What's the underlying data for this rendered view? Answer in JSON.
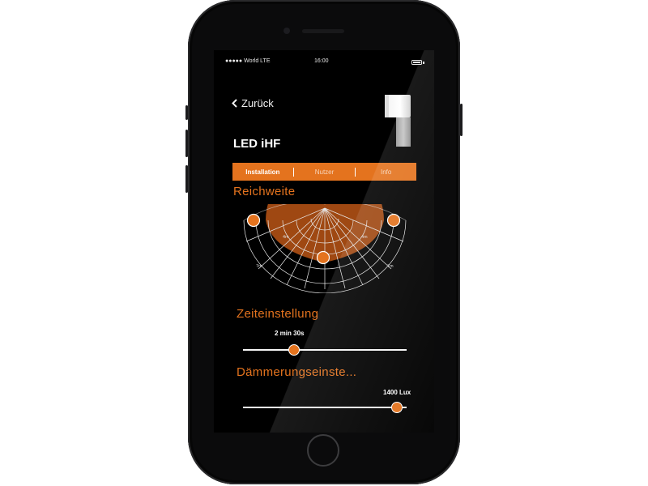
{
  "status_bar": {
    "carrier": "●●●●● World LTE",
    "time": "16:00",
    "battery_icon": "battery-icon"
  },
  "nav": {
    "back_label": "Zurück",
    "back_icon": "chevron-left-icon"
  },
  "device": {
    "title": "LED iHF",
    "image": "sensor-light-product-image"
  },
  "tabs": [
    {
      "label": "Installation",
      "active": true
    },
    {
      "label": "Nutzer",
      "active": false
    },
    {
      "label": "Info",
      "active": false
    }
  ],
  "reichweite": {
    "heading": "Reichweite",
    "ring_labels": [
      "4m",
      "4m",
      "7m",
      "7m"
    ]
  },
  "zeiteinstellung": {
    "heading": "Zeiteinstellung",
    "value_label": "2 min 30s",
    "fraction": 0.31
  },
  "daemmerung": {
    "heading": "Dämmerungseinste...",
    "value_label": "1400 Lux",
    "fraction": 0.94
  },
  "colors": {
    "accent": "#e4731e",
    "background": "#000000",
    "text": "#ffffff"
  }
}
